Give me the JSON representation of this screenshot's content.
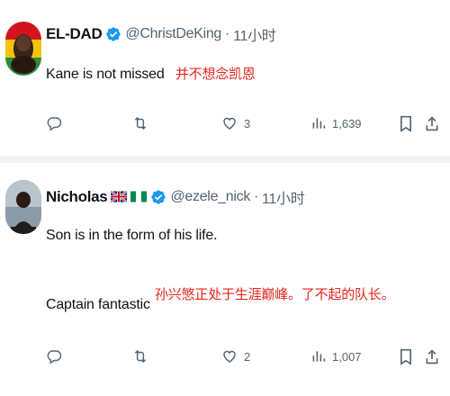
{
  "tweets": [
    {
      "name": "EL-DAD",
      "handle": "@ChristDeKing",
      "separator": "·",
      "time": "11小时",
      "text": "Kane is not missed",
      "translation": "并不想念凯恩",
      "likes": "3",
      "views": "1,639"
    },
    {
      "name": "Nicholas",
      "handle": "@ezele_nick",
      "separator": "·",
      "time": "11小时",
      "text_line1": "Son is in the form of his life.",
      "text_line2": "Captain fantastic",
      "translation": "孙兴慜正处于生涯巅峰。了不起的队长。",
      "likes": "2",
      "views": "1,007"
    }
  ],
  "icons": [
    "reply-icon",
    "retweet-icon",
    "like-icon",
    "views-icon",
    "bookmark-icon",
    "share-icon",
    "verified-badge-icon",
    "uk-flag-icon",
    "nigeria-flag-icon"
  ],
  "colors": {
    "verified": "#1d9bf0",
    "translation": "#e8261a",
    "muted": "#536471"
  }
}
